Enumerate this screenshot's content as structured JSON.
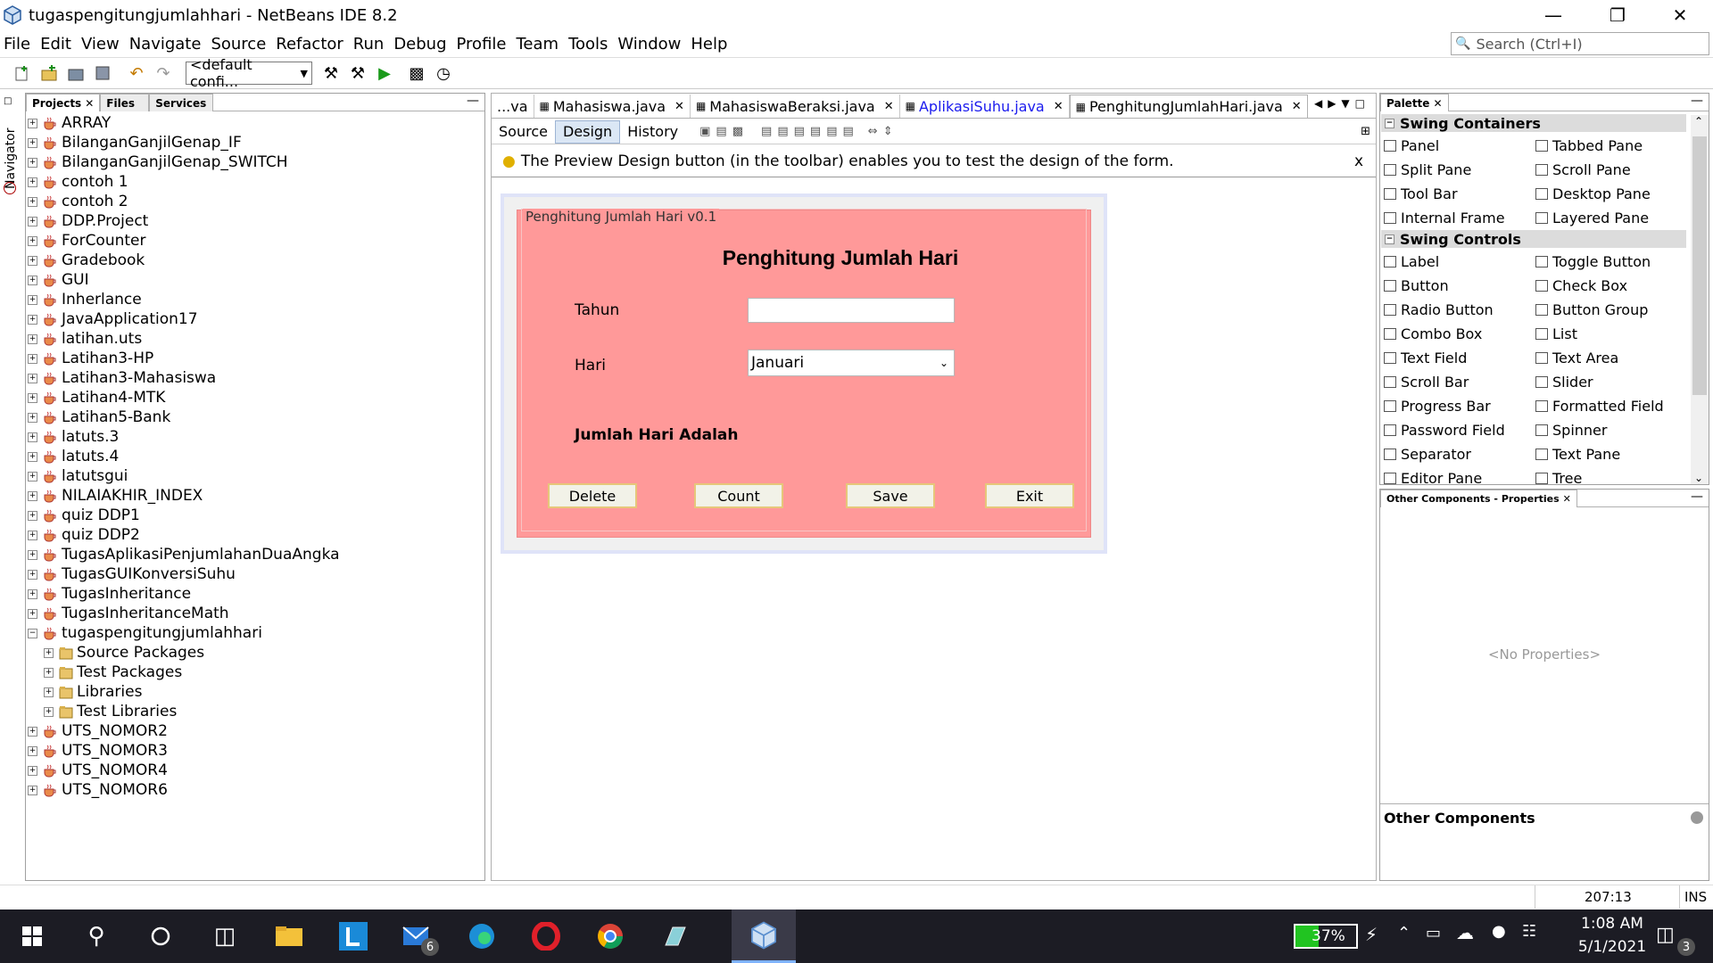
{
  "window": {
    "title": "tugaspengitungjumlahhari - NetBeans IDE 8.2"
  },
  "menu": [
    "File",
    "Edit",
    "View",
    "Navigate",
    "Source",
    "Refactor",
    "Run",
    "Debug",
    "Profile",
    "Team",
    "Tools",
    "Window",
    "Help"
  ],
  "search": {
    "placeholder": "Search (Ctrl+I)"
  },
  "toolbar": {
    "config": "<default confi..."
  },
  "side": {
    "navigator": "Navigator"
  },
  "projects_panel": {
    "tabs": [
      "Projects",
      "Files",
      "Services"
    ],
    "items": [
      "ARRAY",
      "BilanganGanjilGenap_IF",
      "BilanganGanjilGenap_SWITCH",
      "contoh 1",
      "contoh 2",
      "DDP.Project",
      "ForCounter",
      "Gradebook",
      "GUI",
      "Inherlance",
      "JavaApplication17",
      "latihan.uts",
      "Latihan3-HP",
      "Latihan3-Mahasiswa",
      "Latihan4-MTK",
      "Latihan5-Bank",
      "latuts.3",
      "latuts.4",
      "latutsgui",
      "NILAIAKHIR_INDEX",
      "quiz DDP1",
      "quiz DDP2",
      "TugasAplikasiPenjumlahanDuaAngka",
      "TugasGUIKonversiSuhu",
      "TugasInheritance",
      "TugasInheritanceMath",
      "tugaspengitungjumlahhari"
    ],
    "children": [
      "Source Packages",
      "Test Packages",
      "Libraries",
      "Test Libraries"
    ],
    "after": [
      "UTS_NOMOR2",
      "UTS_NOMOR3",
      "UTS_NOMOR4",
      "UTS_NOMOR6"
    ]
  },
  "editor": {
    "tabs": [
      "...va",
      "Mahasiswa.java",
      "MahasiswaBeraksi.java",
      "AplikasiSuhu.java",
      "PenghitungJumlahHari.java"
    ],
    "subtabs": [
      "Source",
      "Design",
      "History"
    ],
    "hint": "The Preview Design button (in the toolbar) enables you to test the design of the form.",
    "hint_close": "x"
  },
  "form": {
    "border_title": "Penghitung Jumlah Hari v0.1",
    "heading": "Penghitung Jumlah Hari",
    "label_tahun": "Tahun",
    "label_hari": "Hari",
    "tahun_value": "",
    "hari_selected": "Januari",
    "label_result": "Jumlah Hari Adalah",
    "buttons": {
      "delete": "Delete",
      "count": "Count",
      "save": "Save",
      "exit": "Exit"
    },
    "bg_color": "#ff9999"
  },
  "palette": {
    "title": "Palette",
    "containers_header": "Swing Containers",
    "containers": [
      "Panel",
      "Tabbed Pane",
      "Split Pane",
      "Scroll Pane",
      "Tool Bar",
      "Desktop Pane",
      "Internal Frame",
      "Layered Pane"
    ],
    "controls_header": "Swing Controls",
    "controls": [
      "Label",
      "Toggle Button",
      "Button",
      "Check Box",
      "Radio Button",
      "Button Group",
      "Combo Box",
      "List",
      "Text Field",
      "Text Area",
      "Scroll Bar",
      "Slider",
      "Progress Bar",
      "Formatted Field",
      "Password Field",
      "Spinner",
      "Separator",
      "Text Pane",
      "Editor Pane",
      "Tree"
    ]
  },
  "properties": {
    "title": "Other Components - Properties",
    "empty": "<No Properties>",
    "footer": "Other Components"
  },
  "statusbar": {
    "position": "207:13",
    "mode": "INS"
  },
  "taskbar": {
    "battery": "37%",
    "time": "1:08 AM",
    "date": "5/1/2021",
    "mail_badge": "6",
    "notif_badge": "3"
  }
}
